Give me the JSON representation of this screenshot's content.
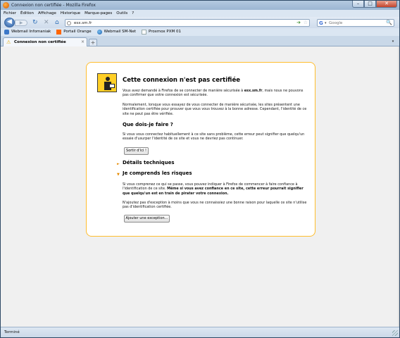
{
  "window": {
    "title": "Connexion non certifiée - Mozilla Firefox",
    "buttons": {
      "minimize": "–",
      "maximize": "□",
      "close": "✕"
    }
  },
  "menu": [
    "Fichier",
    "Édition",
    "Affichage",
    "Historique",
    "Marque-pages",
    "Outils",
    "?"
  ],
  "nav": {
    "back": "◀",
    "forward": "▶",
    "reload": "↻",
    "stop": "✕",
    "home": "⌂",
    "url": "esx.sm.fr",
    "go": "➔",
    "star": "☆",
    "search_engine": "G",
    "search_placeholder": "Google",
    "search_icon": "🔍"
  },
  "bookmarks": [
    {
      "label": "Webmail Infomaniak",
      "icon": "page-icon"
    },
    {
      "label": "Portail Orange",
      "icon": "orange-icon"
    },
    {
      "label": "Webmail SM-Net",
      "icon": "globe-icon"
    },
    {
      "label": "Proxmox PXM 01",
      "icon": "page-icon"
    }
  ],
  "tabs": [
    {
      "label": "Connexion non certifiée",
      "close": "×"
    }
  ],
  "new_tab": "+",
  "tab_list": "▾",
  "error": {
    "title": "Cette connexion n'est pas certifiée",
    "p1_a": "Vous avez demandé à Firefox de se connecter de manière sécurisée à ",
    "p1_host": "esx.sm.fr",
    "p1_b": ", mais nous ne pouvons pas confirmer que votre connexion est sécurisée.",
    "p2": "Normalement, lorsque vous essayez de vous connecter de manière sécurisée, les sites présentent une identification certifiée pour prouver que vous vous trouvez à la bonne adresse. Cependant, l'identité de ce site ne peut pas être vérifiée.",
    "what_title": "Que dois-je faire ?",
    "what_text": "Si vous vous connectez habituellement à ce site sans problème, cette erreur peut signifier que quelqu'un essaie d'usurper l'identité de ce site et vous ne devriez pas continuer.",
    "get_out_button": "Sortir d'ici !",
    "technical_title": "Détails techniques",
    "risks_title": "Je comprends les risques",
    "risks_p1_a": "Si vous comprenez ce qui se passe, vous pouvez indiquer à Firefox de commencer à faire confiance à l'identification de ce site. ",
    "risks_p1_b": "Même si vous avez confiance en ce site, cette erreur pourrait signifier que quelqu'un est en train de pirater votre connexion.",
    "risks_p2": "N'ajoutez pas d'exception à moins que vous ne connaissiez une bonne raison pour laquelle ce site n'utilise pas d'identification certifiée.",
    "add_exception_button": "Ajouter une exception..."
  },
  "status": "Terminé"
}
